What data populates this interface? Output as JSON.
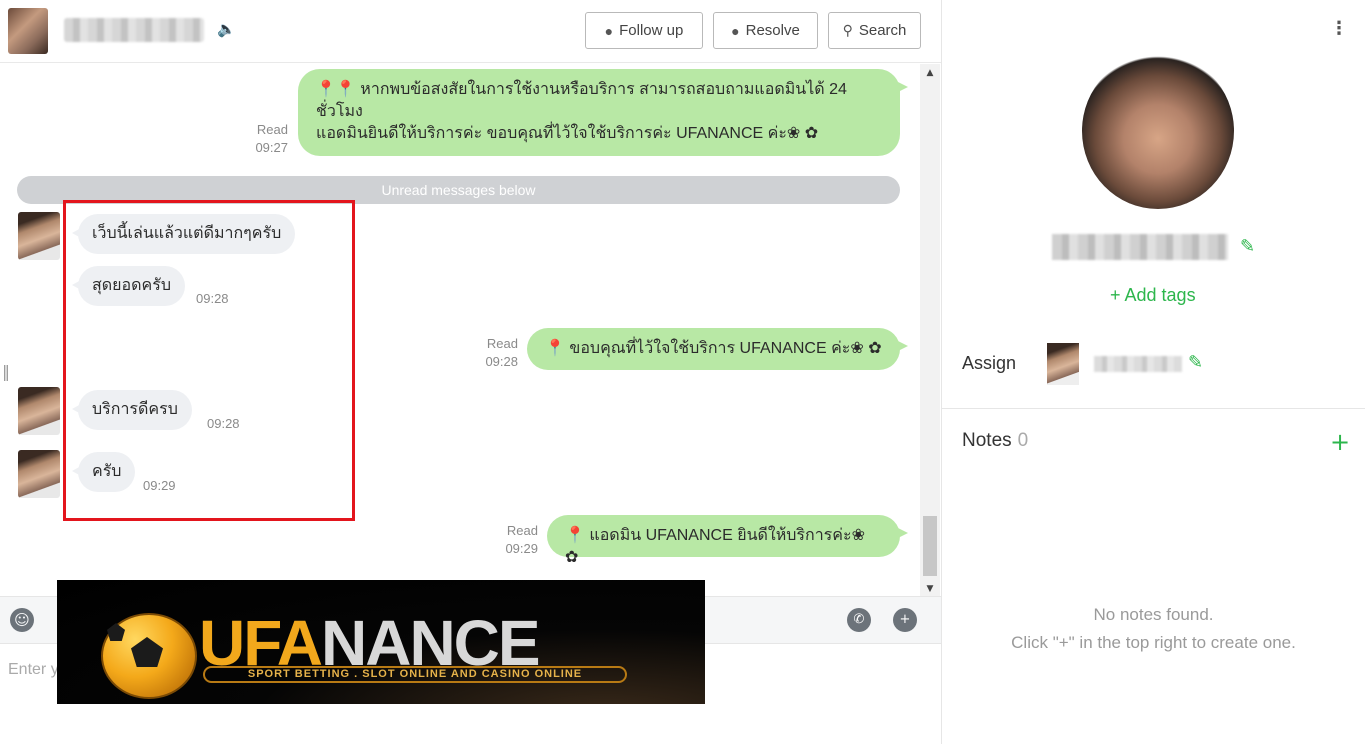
{
  "header": {
    "follow_up_label": "Follow up",
    "resolve_label": "Resolve",
    "search_label": "Search",
    "speaker_icon": "speaker-icon"
  },
  "messages": [
    {
      "direction": "out",
      "status": "Read",
      "time": "09:27",
      "lines": [
        "หากพบข้อสงสัยในการใช้งานหรือบริการ สามารถสอบถามแอดมินได้ 24",
        "ชั่วโมง",
        "แอดมินยินดีให้บริการค่ะ ขอบคุณที่ไว้ใจใช้บริการค่ะ UFANANCE ค่ะ❀ ✿"
      ]
    },
    {
      "direction": "divider",
      "text": "Unread messages below"
    },
    {
      "direction": "in",
      "text": "เว็บนี้เล่นแล้วแต่ดีมากๆครับ",
      "time": ""
    },
    {
      "direction": "in",
      "text": "สุดยอดครับ",
      "time": "09:28"
    },
    {
      "direction": "out",
      "status": "Read",
      "time": "09:28",
      "lines": [
        "ขอบคุณที่ไว้ใจใช้บริการ UFANANCE ค่ะ❀ ✿"
      ]
    },
    {
      "direction": "in",
      "text": "บริการดีครบ",
      "time": "09:28"
    },
    {
      "direction": "in",
      "text": "ครับ",
      "time": "09:29"
    },
    {
      "direction": "out",
      "status": "Read",
      "time": "09:29",
      "lines": [
        "แอดมิน UFANANCE ยินดีให้บริการค่ะ❀ ✿"
      ]
    }
  ],
  "composer": {
    "placeholder": "Enter y"
  },
  "banner": {
    "logo_part1": "UFA",
    "logo_part2": "NANCE",
    "tagline": "SPORT BETTING . SLOT ONLINE AND CASINO ONLINE"
  },
  "side": {
    "add_tags_label": "+ Add tags",
    "assign_label": "Assign",
    "notes_label": "Notes",
    "notes_count": "0",
    "notes_add": "+",
    "empty_line1": "No notes found.",
    "empty_line2": "Click \"+\" in the top right to create one."
  },
  "colors": {
    "accent_green": "#2db64c",
    "outgoing_bubble": "#b8e8a5",
    "incoming_bubble": "#eef0f3",
    "highlight_box": "#e3151d"
  }
}
